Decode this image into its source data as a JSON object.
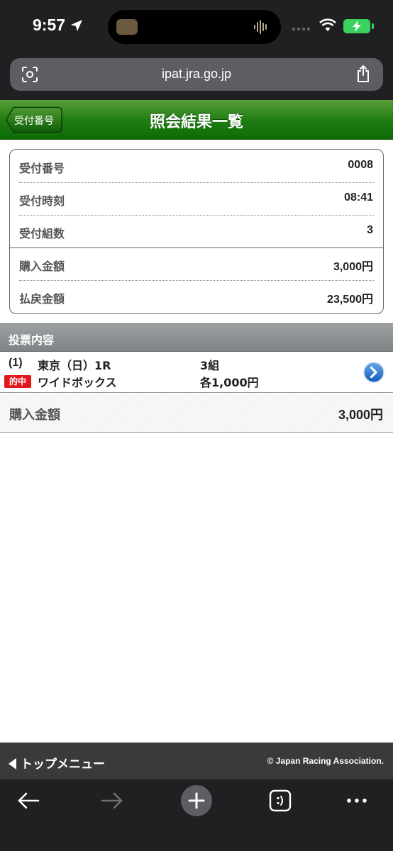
{
  "status_bar": {
    "time": "9:57"
  },
  "browser": {
    "url": "ipat.jra.go.jp"
  },
  "header": {
    "back_label": "受付番号",
    "title": "照会結果一覧"
  },
  "receipt": {
    "rows": [
      {
        "label": "受付番号",
        "value": "0008"
      },
      {
        "label": "受付時刻",
        "value": "08:41"
      },
      {
        "label": "受付組数",
        "value": "3"
      },
      {
        "label": "購入金額",
        "value": "3,000円"
      },
      {
        "label": "払戻金額",
        "value": "23,500円"
      }
    ]
  },
  "section": {
    "title": "投票内容"
  },
  "bet": {
    "number": "(1)",
    "race": "東京（日）1R",
    "hit_badge": "的中",
    "bet_type": "ワイドボックス",
    "combos": "3組",
    "amount_each": "各1,000円"
  },
  "total": {
    "label": "購入金額",
    "value": "3,000円"
  },
  "footer": {
    "top_menu": "トップメニュー",
    "copyright": "© Japan Racing Association."
  },
  "colors": {
    "header_green": "#217e15",
    "hit_red": "#e1191e",
    "detail_blue": "#1d6ec8"
  }
}
